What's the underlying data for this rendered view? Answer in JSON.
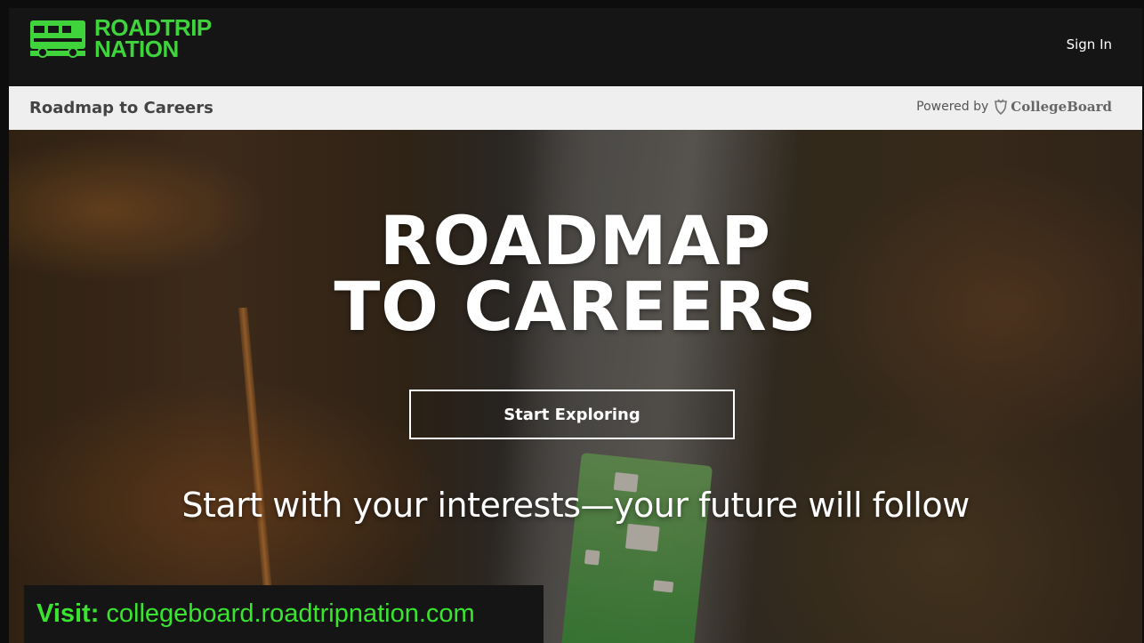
{
  "header": {
    "logo_line1": "ROADTRIP",
    "logo_line2": "NATION",
    "signin_label": "Sign In"
  },
  "subheader": {
    "title": "Roadmap to Careers",
    "powered_by": "Powered by",
    "partner": "CollegeBoard"
  },
  "hero": {
    "title_line1": "ROADMAP",
    "title_line2": "TO CAREERS",
    "cta_label": "Start Exploring",
    "tagline": "Start with your interests—your future will follow"
  },
  "banner": {
    "label": "Visit:",
    "url": "collegeboard.roadtripnation.com"
  },
  "colors": {
    "brand_green": "#3fd43b",
    "banner_green": "#39e52f",
    "nav_bg": "#151515",
    "subbar_bg": "#efefef"
  },
  "icons": {
    "logo": "rv-icon",
    "partner_logo": "acorn-icon"
  }
}
